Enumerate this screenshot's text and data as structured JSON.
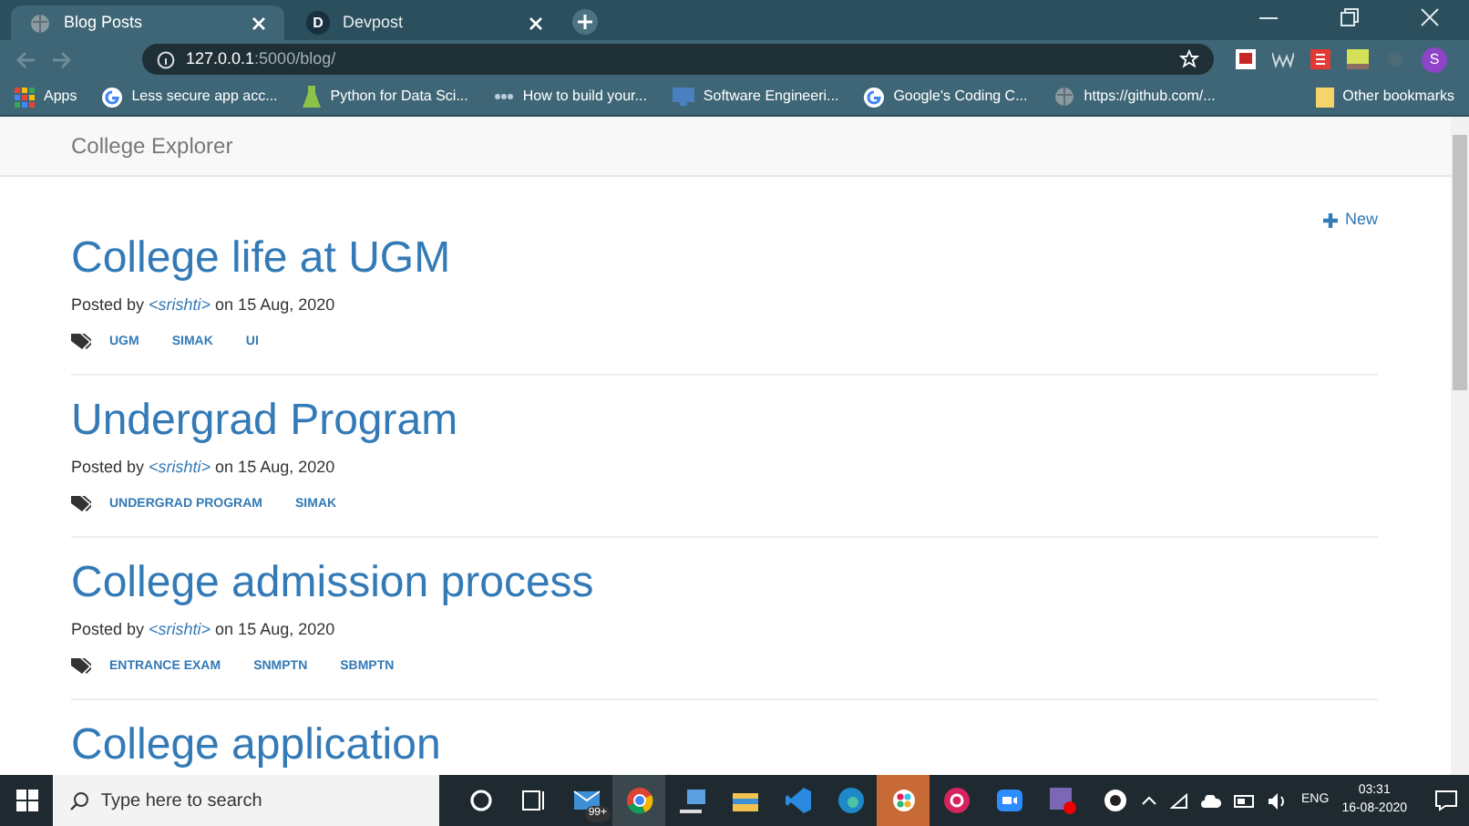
{
  "browser": {
    "tabs": [
      {
        "title": "Blog Posts",
        "selected": true,
        "kind": "globe"
      },
      {
        "title": "Devpost",
        "selected": false,
        "kind": "letter",
        "letter": "D"
      }
    ],
    "address": {
      "host": "127.0.0.1",
      "path": ":5000/blog/"
    },
    "profile": "S",
    "bookmarks": [
      {
        "label": "Apps",
        "kind": "apps"
      },
      {
        "label": "Less secure app acc...",
        "kind": "google"
      },
      {
        "label": "Python for Data Sci...",
        "kind": "python"
      },
      {
        "label": "How to build your...",
        "kind": "dots"
      },
      {
        "label": "Software Engineeri...",
        "kind": "screen"
      },
      {
        "label": "Google's Coding C...",
        "kind": "google"
      },
      {
        "label": "https://github.com/...",
        "kind": "globe"
      }
    ],
    "other_bookmarks": "Other bookmarks"
  },
  "page": {
    "brand": "College Explorer",
    "new_button": "New",
    "posts": [
      {
        "title": "College life at UGM",
        "meta_prefix": "Posted by",
        "author": "<srishti>",
        "meta_suffix": "on 15 Aug, 2020",
        "tags": [
          "UGM",
          "SIMAK",
          "UI"
        ]
      },
      {
        "title": "Undergrad Program",
        "meta_prefix": "Posted by",
        "author": "<srishti>",
        "meta_suffix": "on 15 Aug, 2020",
        "tags": [
          "UNDERGRAD PROGRAM",
          "SIMAK"
        ]
      },
      {
        "title": "College admission process",
        "meta_prefix": "Posted by",
        "author": "<srishti>",
        "meta_suffix": "on 15 Aug, 2020",
        "tags": [
          "ENTRANCE EXAM",
          "SNMPTN",
          "SBMPTN"
        ]
      },
      {
        "title": "College application"
      }
    ]
  },
  "taskbar": {
    "search_placeholder": "Type here to search",
    "mail_badge": "99+",
    "language": "ENG",
    "time": "03:31",
    "date": "16-08-2020"
  }
}
